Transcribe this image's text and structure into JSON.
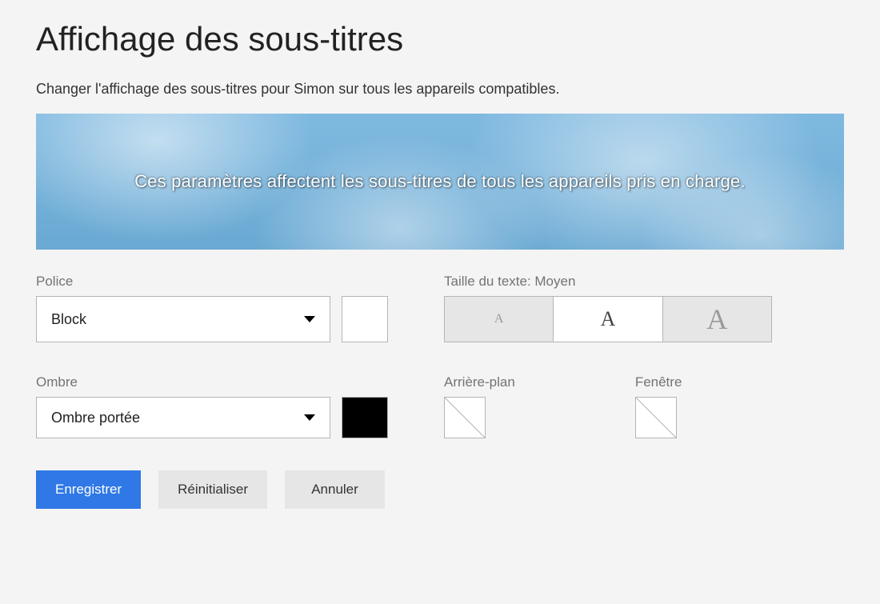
{
  "title": "Affichage des sous-titres",
  "description": "Changer l'affichage des sous-titres pour Simon sur tous les appareils compatibles.",
  "preview_text": "Ces paramètres affectent les sous-titres de tous les appareils pris en charge.",
  "police": {
    "label": "Police",
    "value": "Block",
    "swatch_color": "#ffffff"
  },
  "taille": {
    "label_prefix": "Taille du texte:",
    "value_label": "Moyen",
    "full_label": "Taille du texte: Moyen",
    "options": [
      {
        "glyph": "A",
        "size": "small",
        "selected": false
      },
      {
        "glyph": "A",
        "size": "medium",
        "selected": true
      },
      {
        "glyph": "A",
        "size": "large",
        "selected": false
      }
    ]
  },
  "ombre": {
    "label": "Ombre",
    "value": "Ombre portée",
    "swatch_color": "#000000"
  },
  "arriere_plan": {
    "label": "Arrière-plan",
    "value": "none"
  },
  "fenetre": {
    "label": "Fenêtre",
    "value": "none"
  },
  "buttons": {
    "save": "Enregistrer",
    "reset": "Réinitialiser",
    "cancel": "Annuler"
  }
}
